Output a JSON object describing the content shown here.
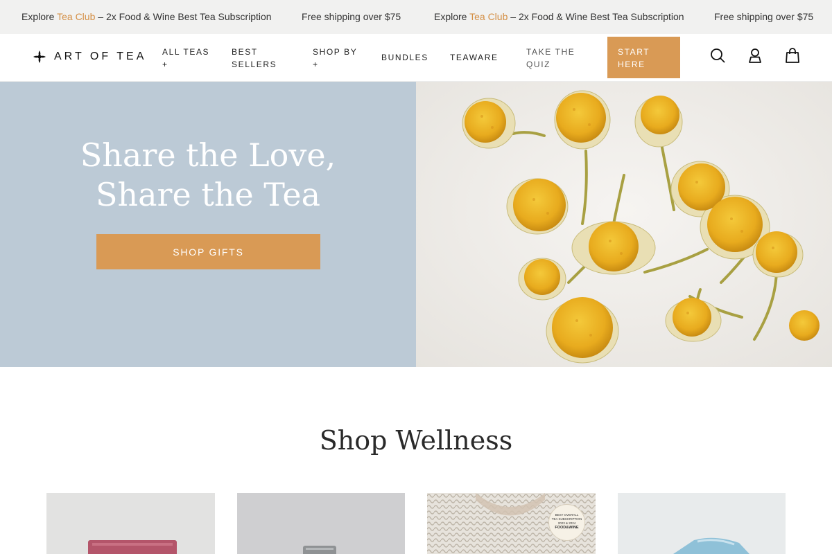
{
  "announcement": {
    "msg1_prefix": "Explore ",
    "msg1_link": "Tea Club",
    "msg1_suffix": " – 2x Food & Wine Best Tea Subscription",
    "msg2": "Free shipping over $75",
    "msg3_prefix": "Explore ",
    "msg3_link": "Tea Club",
    "msg3_suffix": " – 2x Food & Wine Best Tea Subscription",
    "msg4": "Free shipping over $75"
  },
  "header": {
    "logo_text": "ART OF TEA",
    "nav": {
      "all_teas": "All Teas",
      "all_teas_plus": "+",
      "best_sellers_1": "Best",
      "best_sellers_2": "Sellers",
      "shop_by": "Shop By",
      "shop_by_plus": "+",
      "bundles": "Bundles",
      "teaware": "Teaware",
      "quiz_1": "Take the",
      "quiz_2": "Quiz",
      "start_1": "Start",
      "start_2": "Here"
    },
    "icons": [
      "search-icon",
      "account-icon",
      "cart-icon"
    ]
  },
  "hero": {
    "title_line1": "Share the Love,",
    "title_line2": "Share the Tea",
    "button_label": "Shop Gifts"
  },
  "wellness": {
    "title": "Shop Wellness",
    "badge_line1": "BEST OVERALL",
    "badge_line2": "TEA SUBSCRIPTION",
    "badge_line3": "2023 & 2024",
    "badge_brand": "FOOD&WINE"
  },
  "colors": {
    "accent": "#d99a55",
    "hero_bg": "#bccad6",
    "announce_bg": "#f1f1f0"
  }
}
